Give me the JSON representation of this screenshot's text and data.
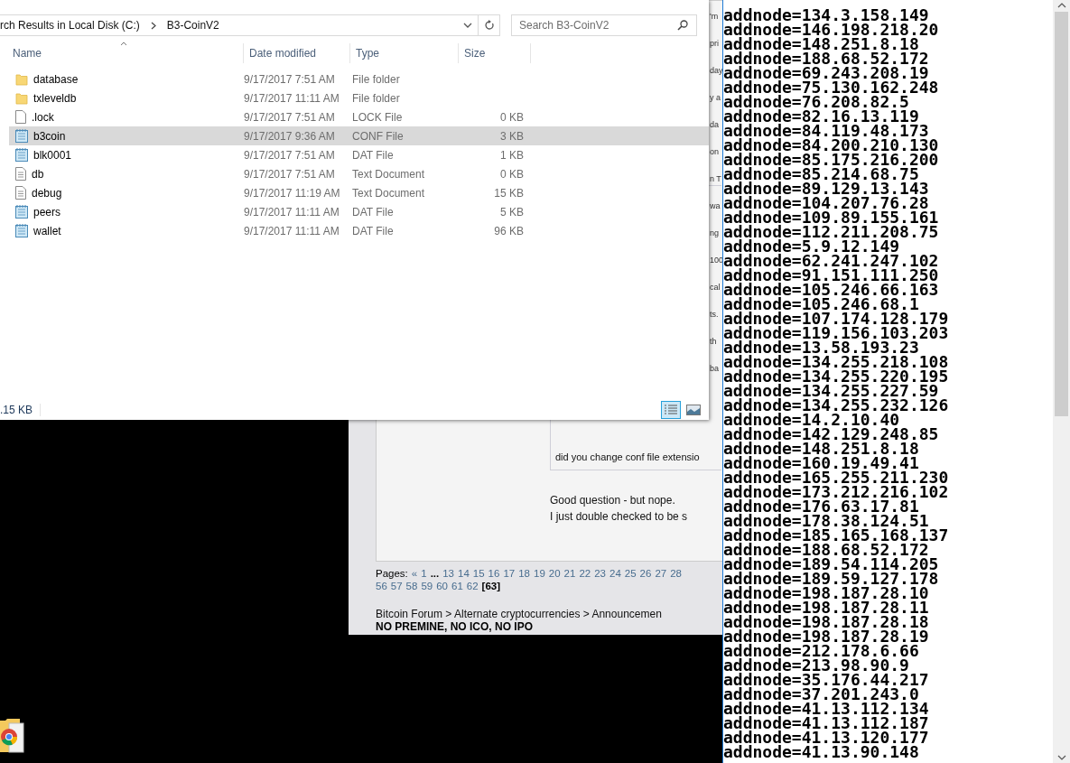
{
  "explorer": {
    "breadcrumb": [
      "rch Results in Local Disk (C:)",
      "B3-CoinV2"
    ],
    "search": {
      "placeholder": "Search B3-CoinV2"
    },
    "columns": [
      "Name",
      "Date modified",
      "Type",
      "Size"
    ],
    "files": [
      {
        "name": "database",
        "kind": "folder",
        "date": "9/17/2017 7:51 AM",
        "type": "File folder",
        "selected": false
      },
      {
        "name": "txleveldb",
        "kind": "folder",
        "date": "9/17/2017 11:11 AM",
        "type": "File folder",
        "selected": false
      },
      {
        "name": ".lock",
        "kind": "blank",
        "date": "9/17/2017 7:51 AM",
        "type": "LOCK File",
        "size": "0 KB",
        "selected": false
      },
      {
        "name": "b3coin",
        "kind": "data",
        "date": "9/17/2017 9:36 AM",
        "type": "CONF File",
        "size": "3 KB",
        "selected": true
      },
      {
        "name": "blk0001",
        "kind": "data",
        "date": "9/17/2017 7:51 AM",
        "type": "DAT File",
        "size": "1 KB",
        "selected": false
      },
      {
        "name": "db",
        "kind": "text",
        "date": "9/17/2017 7:51 AM",
        "type": "Text Document",
        "size": "0 KB",
        "selected": false
      },
      {
        "name": "debug",
        "kind": "text",
        "date": "9/17/2017 11:19 AM",
        "type": "Text Document",
        "size": "15 KB",
        "selected": false
      },
      {
        "name": "peers",
        "kind": "data",
        "date": "9/17/2017 11:11 AM",
        "type": "DAT File",
        "size": "5 KB",
        "selected": false
      },
      {
        "name": "wallet",
        "kind": "data",
        "date": "9/17/2017 11:11 AM",
        "type": "DAT File",
        "size": "96 KB",
        "selected": false
      }
    ],
    "status": ".15 KB",
    "views": [
      {
        "kind": "details",
        "selected": true
      },
      {
        "kind": "large-icons",
        "selected": false
      }
    ]
  },
  "forum": {
    "edge_fragments": [
      "'m",
      "pri",
      "day",
      "y a",
      "da",
      "on",
      "n T",
      "wa",
      "ng",
      "100",
      "cal",
      "ts.",
      "th",
      "ba"
    ],
    "quote": "did you change conf file extensio",
    "reply": [
      "Good question - but nope.",
      "I just double checked to be s"
    ],
    "pages_label": "Pages:",
    "pages_rows": [
      [
        {
          "text": "«",
          "kind": "link"
        },
        {
          "text": "1",
          "kind": "link"
        },
        {
          "text": "...",
          "kind": "ellipsis"
        },
        {
          "text": "13",
          "kind": "link"
        },
        {
          "text": "14",
          "kind": "link"
        },
        {
          "text": "15",
          "kind": "link"
        },
        {
          "text": "16",
          "kind": "link"
        },
        {
          "text": "17",
          "kind": "link"
        },
        {
          "text": "18",
          "kind": "link"
        },
        {
          "text": "19",
          "kind": "link"
        },
        {
          "text": "20",
          "kind": "link"
        },
        {
          "text": "21",
          "kind": "link"
        },
        {
          "text": "22",
          "kind": "link"
        },
        {
          "text": "23",
          "kind": "link"
        },
        {
          "text": "24",
          "kind": "link"
        },
        {
          "text": "25",
          "kind": "link"
        },
        {
          "text": "26",
          "kind": "link"
        },
        {
          "text": "27",
          "kind": "link"
        },
        {
          "text": "28",
          "kind": "link"
        }
      ],
      [
        {
          "text": "56",
          "kind": "link"
        },
        {
          "text": "57",
          "kind": "link"
        },
        {
          "text": "58",
          "kind": "link"
        },
        {
          "text": "59",
          "kind": "link"
        },
        {
          "text": "60",
          "kind": "link"
        },
        {
          "text": "61",
          "kind": "link"
        },
        {
          "text": "62",
          "kind": "link"
        },
        {
          "text": "[63]",
          "kind": "current"
        }
      ]
    ],
    "breadcrumb": "Bitcoin Forum > Alternate cryptocurrencies > Announcemen",
    "topic": "NO PREMINE, NO ICO, NO IPO"
  },
  "notepad": {
    "lines": [
      "addnode=134.3.158.149",
      "addnode=146.198.218.20",
      "addnode=148.251.8.18",
      "addnode=188.68.52.172",
      "addnode=69.243.208.19",
      "addnode=75.130.162.248",
      "addnode=76.208.82.5",
      "addnode=82.16.13.119",
      "addnode=84.119.48.173",
      "addnode=84.200.210.130",
      "addnode=85.175.216.200",
      "addnode=85.214.68.75",
      "addnode=89.129.13.143",
      "addnode=104.207.76.28",
      "addnode=109.89.155.161",
      "addnode=112.211.208.75",
      "addnode=5.9.12.149",
      "addnode=62.241.247.102",
      "addnode=91.151.111.250",
      "addnode=105.246.66.163",
      "addnode=105.246.68.1",
      "addnode=107.174.128.179",
      "addnode=119.156.103.203",
      "addnode=13.58.193.23",
      "addnode=134.255.218.108",
      "addnode=134.255.220.195",
      "addnode=134.255.227.59",
      "addnode=134.255.232.126",
      "addnode=14.2.10.40",
      "addnode=142.129.248.85",
      "addnode=148.251.8.18",
      "addnode=160.19.49.41",
      "addnode=165.255.211.230",
      "addnode=173.212.216.102",
      "addnode=176.63.17.81",
      "addnode=178.38.124.51",
      "addnode=185.165.168.137",
      "addnode=188.68.52.172",
      "addnode=189.54.114.205",
      "addnode=189.59.127.178",
      "addnode=198.187.28.10",
      "addnode=198.187.28.11",
      "addnode=198.187.28.18",
      "addnode=198.187.28.19",
      "addnode=212.178.6.66",
      "addnode=213.98.90.9",
      "addnode=35.176.44.217",
      "addnode=37.201.243.0",
      "addnode=41.13.112.134",
      "addnode=41.13.112.187",
      "addnode=41.13.120.177",
      "addnode=41.13.90.148"
    ]
  }
}
